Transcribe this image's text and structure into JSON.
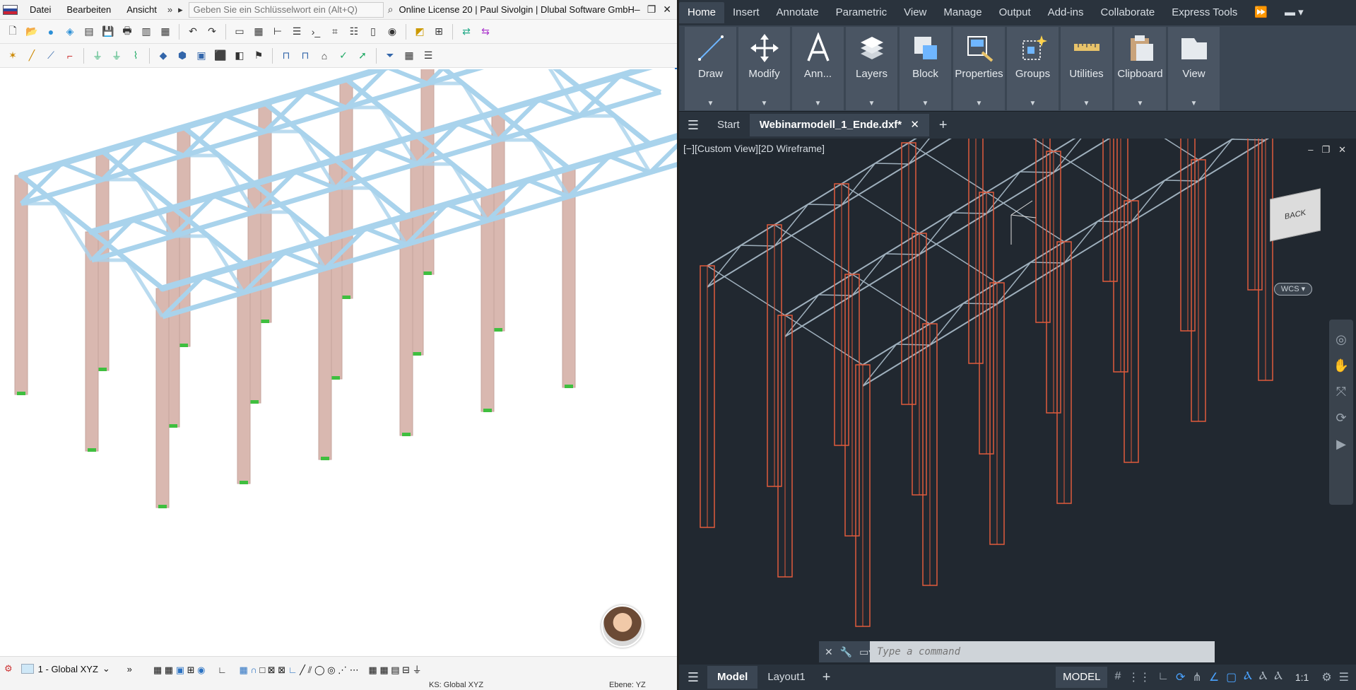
{
  "left": {
    "menu": {
      "items": [
        "Datei",
        "Bearbeiten",
        "Ansicht"
      ],
      "search_placeholder": "Geben Sie ein Schlüsselwort ein (Alt+Q)",
      "license_text": "Online License 20 | Paul Sivolgin | Dlubal Software GmbH"
    },
    "statusbar": {
      "coordinate_system": "1 - Global XYZ",
      "ks_label": "KS: Global XYZ",
      "plane_label": "Ebene: YZ"
    }
  },
  "right": {
    "ribbon_tabs": [
      "Home",
      "Insert",
      "Annotate",
      "Parametric",
      "View",
      "Manage",
      "Output",
      "Add-ins",
      "Collaborate",
      "Express Tools"
    ],
    "active_ribbon_tab": "Home",
    "panels": [
      "Draw",
      "Modify",
      "Ann...",
      "Layers",
      "Block",
      "Properties",
      "Groups",
      "Utilities",
      "Clipboard",
      "View"
    ],
    "file_tabs": {
      "start": "Start",
      "active": "Webinarmodell_1_Ende.dxf*"
    },
    "viewport_label": "[−][Custom View][2D Wireframe]",
    "viewcube_label": "BACK",
    "wcs_label": "WCS",
    "command_placeholder": "Type a command",
    "layout_tabs": [
      "Model",
      "Layout1"
    ],
    "active_layout_tab": "Model",
    "model_button": "MODEL",
    "scale": "1:1",
    "accent_color": "#4aa3ff",
    "column_color": "#e05a3c",
    "truss_color": "#9fb0bd"
  },
  "colors": {
    "rfem_truss": "#a9d3ec",
    "rfem_column": "#d9b8b0",
    "support": "#3fbf3f"
  }
}
